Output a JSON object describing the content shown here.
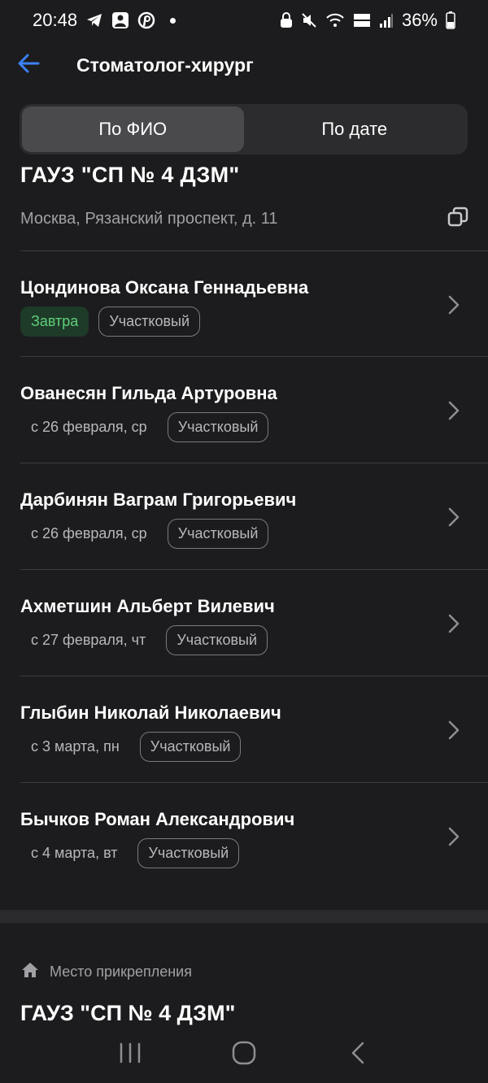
{
  "status_bar": {
    "time": "20:48",
    "battery": "36%"
  },
  "header": {
    "title": "Стоматолог-хирург"
  },
  "tabs": [
    {
      "label": "По ФИО",
      "active": true
    },
    {
      "label": "По дате",
      "active": false
    }
  ],
  "clinic": {
    "name": "ГАУЗ \"СП № 4 ДЗМ\"",
    "address": "Москва, Рязанский проспект, д. 11"
  },
  "doctors": [
    {
      "name": "Цондинова Оксана Геннадьевна",
      "date": "Завтра",
      "type": "Участковый",
      "highlight": true
    },
    {
      "name": "Ованесян Гильда Артуровна",
      "date": "с 26 февраля, ср",
      "type": "Участковый",
      "highlight": false
    },
    {
      "name": "Дарбинян Ваграм Григорьевич",
      "date": "с 26 февраля, ср",
      "type": "Участковый",
      "highlight": false
    },
    {
      "name": "Ахметшин Альберт Вилевич",
      "date": "с 27 февраля, чт",
      "type": "Участковый",
      "highlight": false
    },
    {
      "name": "Глыбин Николай Николаевич",
      "date": "с 3 марта, пн",
      "type": "Участковый",
      "highlight": false
    },
    {
      "name": "Бычков Роман Александрович",
      "date": "с 4 марта, вт",
      "type": "Участковый",
      "highlight": false
    }
  ],
  "attachment": {
    "label": "Место прикрепления",
    "name": "ГАУЗ \"СП № 4 ДЗМ\""
  },
  "colors": {
    "background": "#1c1c1e",
    "accent": "#3b82f6",
    "green": "#5fd07a"
  },
  "icons": {
    "back": "arrow-left-icon",
    "copy": "copy-icon",
    "chevron": "chevron-right-icon",
    "home": "home-icon",
    "nav_recents": "recents-icon",
    "nav_home": "home-circle-icon",
    "nav_back": "back-icon"
  }
}
